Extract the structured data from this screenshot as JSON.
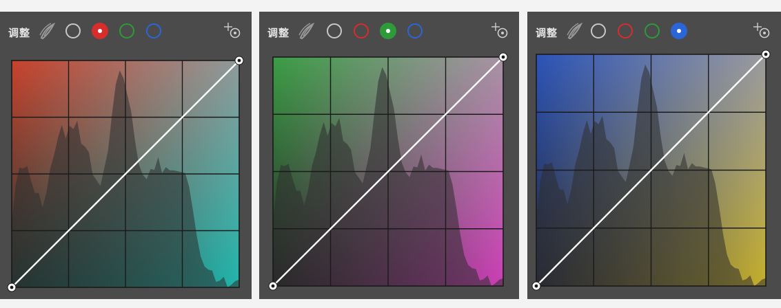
{
  "panels": [
    {
      "id": "red",
      "label": "调整",
      "active_channel": "red",
      "channels": [
        {
          "name": "rgb",
          "color": "#c8c8c8"
        },
        {
          "name": "red",
          "color": "#d62d2d"
        },
        {
          "name": "green",
          "color": "#2f9a3a"
        },
        {
          "name": "blue",
          "color": "#2a66d8"
        }
      ],
      "gradient": {
        "top_left": "#c8422c",
        "top_right": "#8f9a9a",
        "bottom_left": "#1d3a35",
        "bottom_right": "#20b6ac"
      }
    },
    {
      "id": "green",
      "label": "调整",
      "active_channel": "green",
      "channels": [
        {
          "name": "rgb",
          "color": "#c8c8c8"
        },
        {
          "name": "red",
          "color": "#d62d2d"
        },
        {
          "name": "green",
          "color": "#2f9a3a"
        },
        {
          "name": "blue",
          "color": "#2a66d8"
        }
      ],
      "gradient": {
        "top_left": "#3b9d45",
        "top_right": "#a793a4",
        "bottom_left": "#252525",
        "bottom_right": "#cc3fb6"
      }
    },
    {
      "id": "blue",
      "label": "调整",
      "active_channel": "blue",
      "channels": [
        {
          "name": "rgb",
          "color": "#c8c8c8"
        },
        {
          "name": "red",
          "color": "#d62d2d"
        },
        {
          "name": "green",
          "color": "#2f9a3a"
        },
        {
          "name": "blue",
          "color": "#2a66d8"
        }
      ],
      "gradient": {
        "top_left": "#2c54b8",
        "top_right": "#9a9aa0",
        "bottom_left": "#25283a",
        "bottom_right": "#c6b02c"
      }
    }
  ],
  "histogram_levels": [
    0.3,
    0.46,
    0.52,
    0.5,
    0.55,
    0.47,
    0.4,
    0.44,
    0.36,
    0.41,
    0.5,
    0.6,
    0.66,
    0.7,
    0.68,
    0.72,
    0.69,
    0.71,
    0.65,
    0.62,
    0.58,
    0.52,
    0.48,
    0.44,
    0.5,
    0.62,
    0.76,
    0.88,
    0.98,
    0.93,
    0.84,
    0.75,
    0.66,
    0.54,
    0.48,
    0.5,
    0.53,
    0.51,
    0.55,
    0.52,
    0.53,
    0.5,
    0.54,
    0.52,
    0.5,
    0.48,
    0.46,
    0.34,
    0.21,
    0.16,
    0.1,
    0.07,
    0.05,
    0.04,
    0.03,
    0.03,
    0.02,
    0.02,
    0.02,
    0.01
  ]
}
